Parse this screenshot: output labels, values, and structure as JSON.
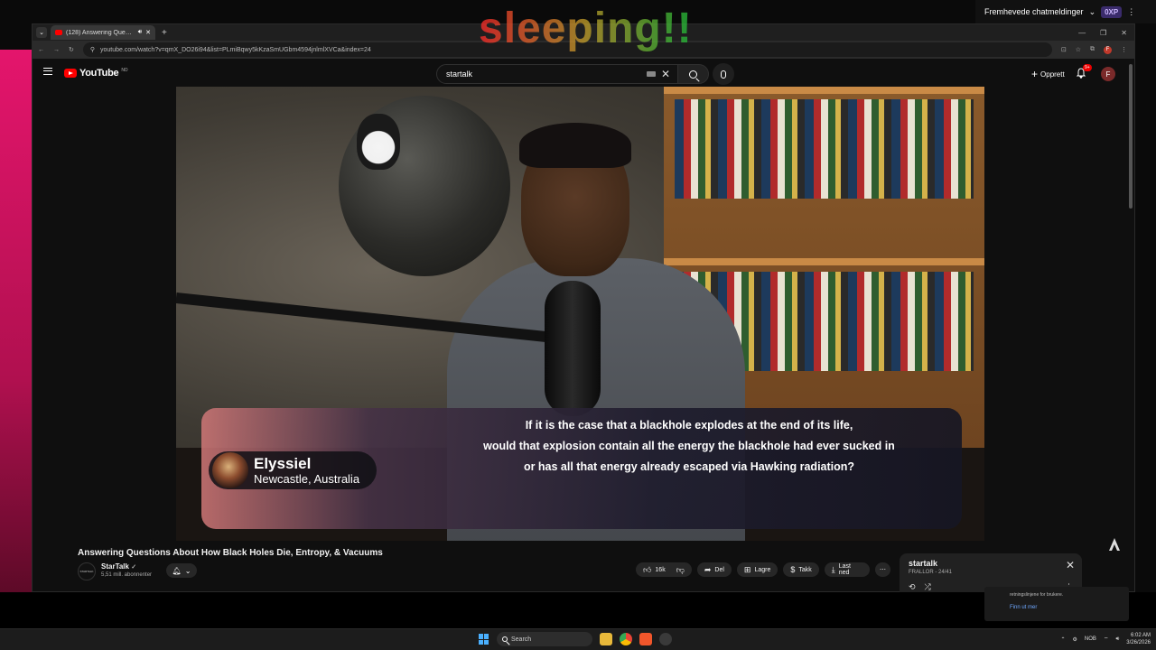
{
  "overlay": {
    "text": "sleeping!!"
  },
  "chat_banner": {
    "label": "Fremhevede chatmeldinger",
    "xp_badge": "0XP"
  },
  "browser": {
    "tab_count_label": "(128) Answering Questions",
    "url": "youtube.com/watch?v=qmX_DO26i94&list=PLmiBqwy5kKzaSmUGbm4594jnlmlXVCa&index=24",
    "profile_initial": "F"
  },
  "youtube": {
    "logo_text": "YouTube",
    "logo_sup": "NO",
    "search_value": "startalk",
    "create_label": "Opprett",
    "notif_badge": "9+",
    "avatar_initial": "F"
  },
  "video": {
    "lower_third": {
      "name": "Elyssiel",
      "location": "Newcastle, Australia",
      "question_lines": [
        "If it is the case that a blackhole explodes at the end of its life,",
        "would that explosion contain all the energy the blackhole had ever sucked in",
        "or has all that energy already escaped via Hawking radiation?"
      ]
    }
  },
  "video_info": {
    "title": "Answering Questions About How Black Holes Die, Entropy, & Vacuums",
    "channel_name": "StarTalk",
    "channel_avatar_text": "STARTALK",
    "subscribers": "5,51 mill. abonnenter",
    "likes": "16k",
    "share_label": "Del",
    "save_label": "Lagre",
    "thanks_label": "Takk",
    "download_label": "Last ned"
  },
  "playlist": {
    "title": "startalk",
    "subtitle": "FRALLOR - 24/41"
  },
  "notification": {
    "text": "retningslinjene for brukere.",
    "link": "Finn ut mer"
  },
  "taskbar": {
    "search_label": "Search",
    "lang": "NOB",
    "time": "6:02 AM",
    "date": "3/26/2026"
  },
  "colors": {
    "youtube_red": "#ff0000",
    "accent_pink": "#e4156c",
    "link_blue": "#6fa8ff"
  }
}
